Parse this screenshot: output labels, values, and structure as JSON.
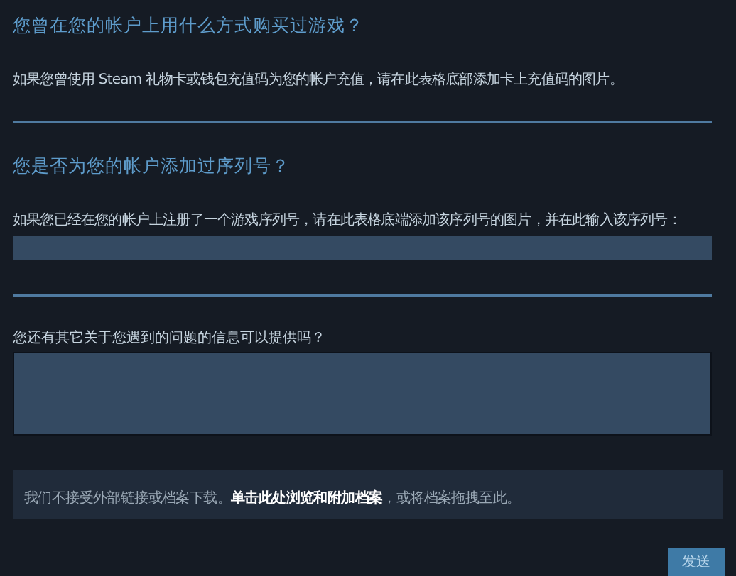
{
  "sections": [
    {
      "kind": "heading",
      "text": "您曾在您的帐户上用什么方式购买过游戏？"
    },
    {
      "kind": "paragraph",
      "text": "如果您曾使用 Steam 礼物卡或钱包充值码为您的帐户充值，请在此表格底部添加卡上充值码的图片。"
    },
    {
      "kind": "divider"
    },
    {
      "kind": "heading",
      "text": "您是否为您的帐户添加过序列号？"
    },
    {
      "kind": "paragraph",
      "text": "如果您已经在您的帐户上注册了一个游戏序列号，请在此表格底端添加该序列号的图片，并在此输入该序列号："
    },
    {
      "kind": "input"
    },
    {
      "kind": "divider"
    },
    {
      "kind": "label",
      "text": "您还有其它关于您遇到的问题的信息可以提供吗？"
    },
    {
      "kind": "textarea"
    }
  ],
  "attachment_notice": {
    "text": "我们不接受外部链接或档案下载。",
    "link": "单击此处浏览和附加档案",
    "rest": "，或将档案拖拽至此。"
  },
  "submit_button": "发送"
}
